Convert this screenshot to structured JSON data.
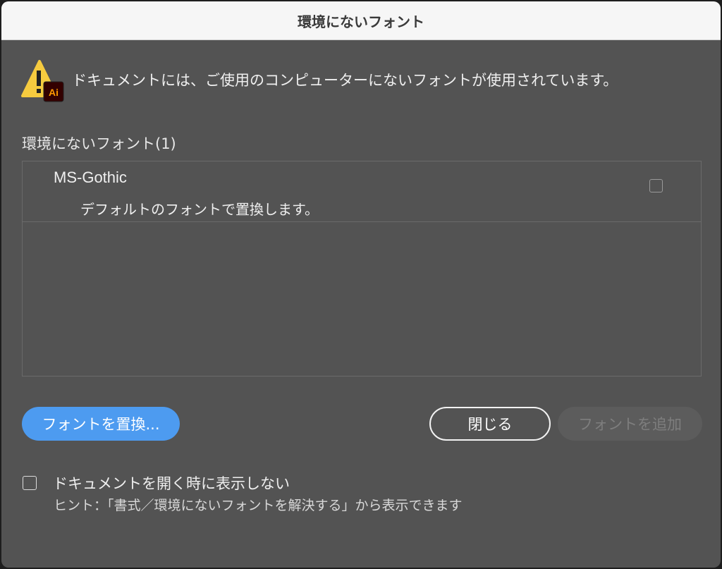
{
  "dialog": {
    "title": "環境にないフォント",
    "message": "ドキュメントには、ご使用のコンピューターにないフォントが使用されています。",
    "app_badge": "Ai",
    "section_label": "環境にないフォント(1)"
  },
  "missing_fonts": [
    {
      "name": "MS-Gothic",
      "action": "デフォルトのフォントで置換します。",
      "checked": false
    }
  ],
  "buttons": {
    "replace": "フォントを置換...",
    "close": "閉じる",
    "add": "フォントを追加"
  },
  "footer": {
    "dont_show_label": "ドキュメントを開く時に表示しない",
    "dont_show_checked": false,
    "hint": "ヒント：「書式／環境にないフォントを解決する」から表示できます"
  },
  "colors": {
    "dialog_bg": "#535353",
    "primary_button": "#4d9bf0",
    "warning_yellow": "#f6cb3f",
    "app_badge_bg": "#330000",
    "app_badge_fg": "#ff9a00"
  },
  "icons": {
    "warning": "warning-triangle-icon",
    "app": "illustrator-app-icon"
  }
}
